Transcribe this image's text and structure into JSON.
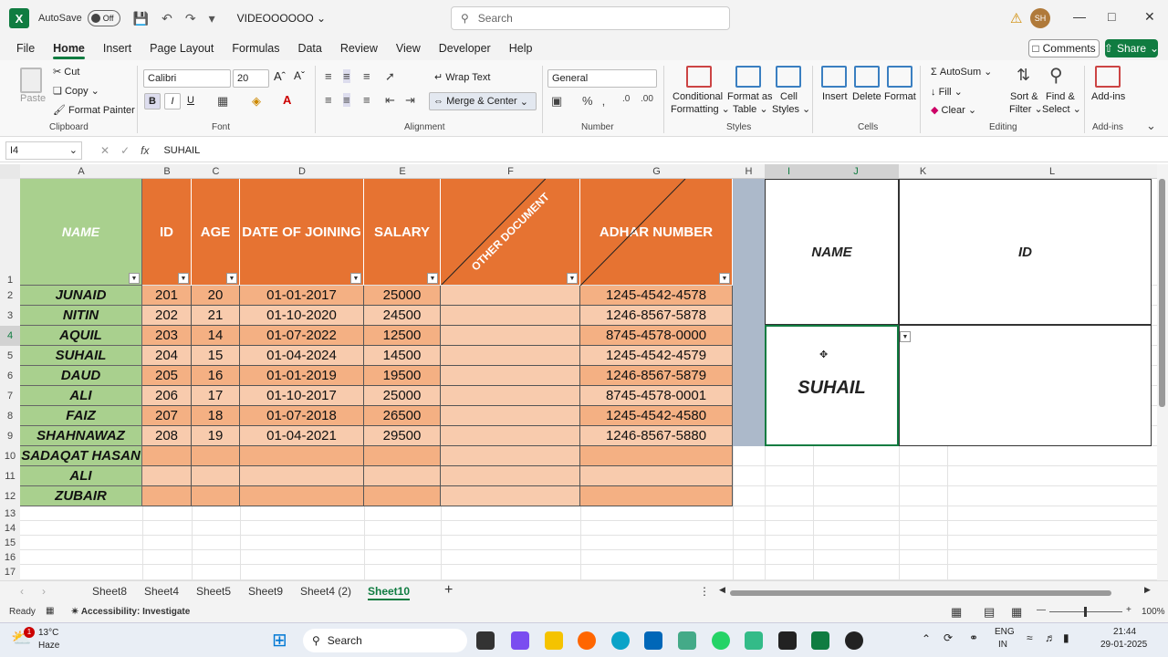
{
  "titlebar": {
    "autosave_label": "AutoSave",
    "toggle_state": "Off",
    "doc_name": "VIDEOOOOOO",
    "search_placeholder": "Search",
    "avatar_initials": "SH"
  },
  "menu": [
    "File",
    "Home",
    "Insert",
    "Page Layout",
    "Formulas",
    "Data",
    "Review",
    "View",
    "Developer",
    "Help"
  ],
  "active_menu": "Home",
  "comments_label": "Comments",
  "share_label": "Share",
  "ribbon": {
    "clipboard": {
      "paste": "Paste",
      "cut": "Cut",
      "copy": "Copy",
      "format_painter": "Format Painter",
      "label": "Clipboard"
    },
    "font": {
      "name": "Calibri",
      "size": "20",
      "label": "Font",
      "bold": "B",
      "italic": "I",
      "underline": "U"
    },
    "alignment": {
      "wrap": "Wrap Text",
      "merge": "Merge & Center",
      "label": "Alignment"
    },
    "number": {
      "format": "General",
      "label": "Number"
    },
    "styles": {
      "cond1": "Conditional",
      "cond2": "Formatting",
      "fmt1": "Format as",
      "fmt2": "Table",
      "cell1": "Cell",
      "cell2": "Styles",
      "label": "Styles"
    },
    "cells": {
      "insert": "Insert",
      "delete": "Delete",
      "format": "Format",
      "label": "Cells"
    },
    "editing": {
      "autosum": "AutoSum",
      "fill": "Fill",
      "clear": "Clear",
      "sort1": "Sort &",
      "sort2": "Filter",
      "find1": "Find &",
      "find2": "Select",
      "label": "Editing"
    },
    "addins": {
      "addins": "Add-ins",
      "label": "Add-ins"
    }
  },
  "formula_bar": {
    "name_box": "I4",
    "formula": "SUHAIL"
  },
  "columns": [
    "A",
    "B",
    "C",
    "D",
    "E",
    "F",
    "G",
    "H",
    "I",
    "J",
    "K",
    "L"
  ],
  "rows": [
    "1",
    "2",
    "3",
    "4",
    "5",
    "6",
    "7",
    "8",
    "9",
    "10",
    "11",
    "12",
    "13",
    "14",
    "15",
    "16",
    "17"
  ],
  "table": {
    "headers": [
      "NAME",
      "ID",
      "AGE",
      "DATE OF JOINING",
      "SALARY",
      "OTHER DOCUMENT",
      "ADHAR NUMBER"
    ],
    "rows": [
      [
        "JUNAID",
        "201",
        "20",
        "01-01-2017",
        "25000",
        "",
        "1245-4542-4578"
      ],
      [
        "NITIN",
        "202",
        "21",
        "01-10-2020",
        "24500",
        "",
        "1246-8567-5878"
      ],
      [
        "AQUIL",
        "203",
        "14",
        "01-07-2022",
        "12500",
        "",
        "8745-4578-0000"
      ],
      [
        "SUHAIL",
        "204",
        "15",
        "01-04-2024",
        "14500",
        "",
        "1245-4542-4579"
      ],
      [
        "DAUD",
        "205",
        "16",
        "01-01-2019",
        "19500",
        "",
        "1246-8567-5879"
      ],
      [
        "ALI",
        "206",
        "17",
        "01-10-2017",
        "25000",
        "",
        "8745-4578-0001"
      ],
      [
        "FAIZ",
        "207",
        "18",
        "01-07-2018",
        "26500",
        "",
        "1245-4542-4580"
      ],
      [
        "SHAHNAWAZ",
        "208",
        "19",
        "01-04-2021",
        "29500",
        "",
        "1246-8567-5880"
      ],
      [
        "SADAQAT HASAN",
        "",
        "",
        "",
        "",
        "",
        ""
      ],
      [
        "ALI",
        "",
        "",
        "",
        "",
        "",
        ""
      ],
      [
        "ZUBAIR",
        "",
        "",
        "",
        "",
        "",
        ""
      ]
    ]
  },
  "lookup": {
    "name_label": "NAME",
    "id_label": "ID",
    "name_value": "SUHAIL"
  },
  "sheets": [
    "Sheet8",
    "Sheet4",
    "Sheet5",
    "Sheet9",
    "Sheet4 (2)",
    "Sheet10"
  ],
  "active_sheet": "Sheet10",
  "status": {
    "ready": "Ready",
    "accessibility": "Accessibility: Investigate",
    "zoom": "100%"
  },
  "taskbar": {
    "temp": "13°C",
    "weather": "Haze",
    "search": "Search",
    "lang1": "ENG",
    "lang2": "IN",
    "time": "21:44",
    "date": "29-01-2025",
    "notif": "1"
  }
}
